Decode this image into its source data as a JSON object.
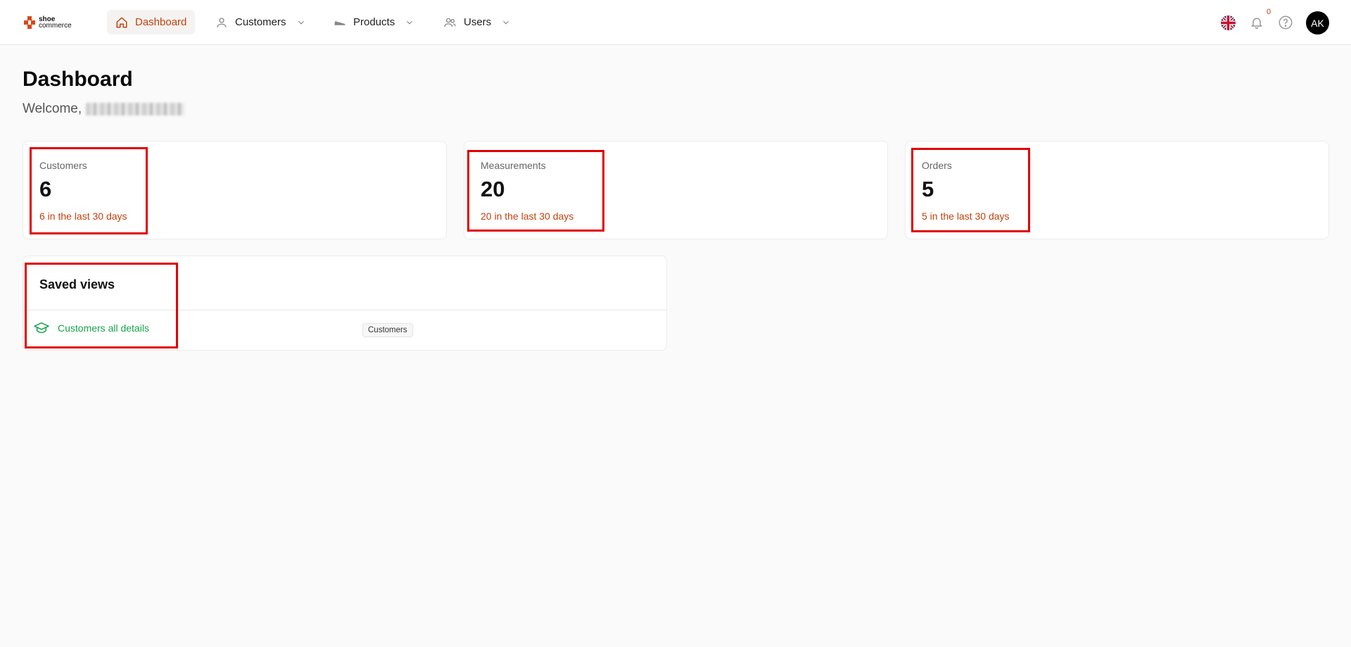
{
  "brand": {
    "line1": "shoe",
    "line2": "commerce"
  },
  "nav": {
    "dashboard": "Dashboard",
    "customers": "Customers",
    "products": "Products",
    "users": "Users"
  },
  "header": {
    "notification_count": "0",
    "avatar_initials": "AK"
  },
  "page": {
    "title": "Dashboard",
    "welcome": "Welcome,"
  },
  "stats": [
    {
      "label": "Customers",
      "value": "6",
      "sub": "6 in the last 30 days"
    },
    {
      "label": "Measurements",
      "value": "20",
      "sub": "20 in the last 30 days"
    },
    {
      "label": "Orders",
      "value": "5",
      "sub": "5 in the last 30 days"
    }
  ],
  "saved_views": {
    "title": "Saved views",
    "items": [
      {
        "name": "Customers all details",
        "tag": "Customers"
      }
    ]
  },
  "colors": {
    "accent": "#c2410c",
    "link_green": "#16a34a",
    "highlight": "#e10000"
  }
}
